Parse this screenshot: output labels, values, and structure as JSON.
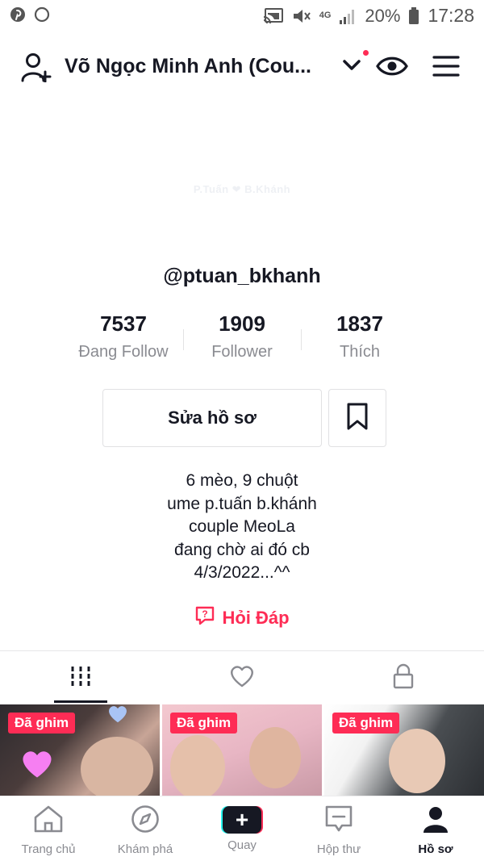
{
  "status_bar": {
    "network": "4G",
    "battery": "20%",
    "time": "17:28",
    "icons": [
      "pinterest-icon",
      "circle-icon",
      "cast-icon",
      "mute-icon",
      "signal-icon",
      "battery-icon"
    ]
  },
  "header": {
    "title": "Võ Ngọc Minh Anh (Cou...",
    "icons": [
      "add-user-icon",
      "chevron-down-icon",
      "eye-icon",
      "menu-icon"
    ]
  },
  "profile": {
    "avatar_watermark": "P.Tuấn ❤ B.Khánh",
    "handle": "@ptuan_bkhanh",
    "stats": [
      {
        "value": "7537",
        "label": "Đang Follow"
      },
      {
        "value": "1909",
        "label": "Follower"
      },
      {
        "value": "1837",
        "label": "Thích"
      }
    ],
    "edit_label": "Sửa hồ sơ",
    "bio": [
      "6 mèo, 9 chuột",
      "ume p.tuấn b.khánh",
      "couple MeoLa",
      "đang chờ ai đó cb",
      "4/3/2022...^^"
    ],
    "qa_label": "Hỏi Đáp"
  },
  "tabs": [
    "grid-icon",
    "heart-icon",
    "lock-icon"
  ],
  "videos": [
    {
      "pin_label": "Đã ghim"
    },
    {
      "pin_label": "Đã ghim"
    },
    {
      "pin_label": "Đã ghim"
    }
  ],
  "bottom_nav": [
    {
      "label": "Trang chủ",
      "icon": "home-icon"
    },
    {
      "label": "Khám phá",
      "icon": "compass-icon"
    },
    {
      "label": "Quay",
      "icon": "plus-icon"
    },
    {
      "label": "Hộp thư",
      "icon": "inbox-icon"
    },
    {
      "label": "Hồ sơ",
      "icon": "profile-icon"
    }
  ],
  "colors": {
    "accent": "#fe2c55",
    "text": "#161823",
    "muted": "#8a8b91",
    "cyan": "#25f4ee"
  }
}
